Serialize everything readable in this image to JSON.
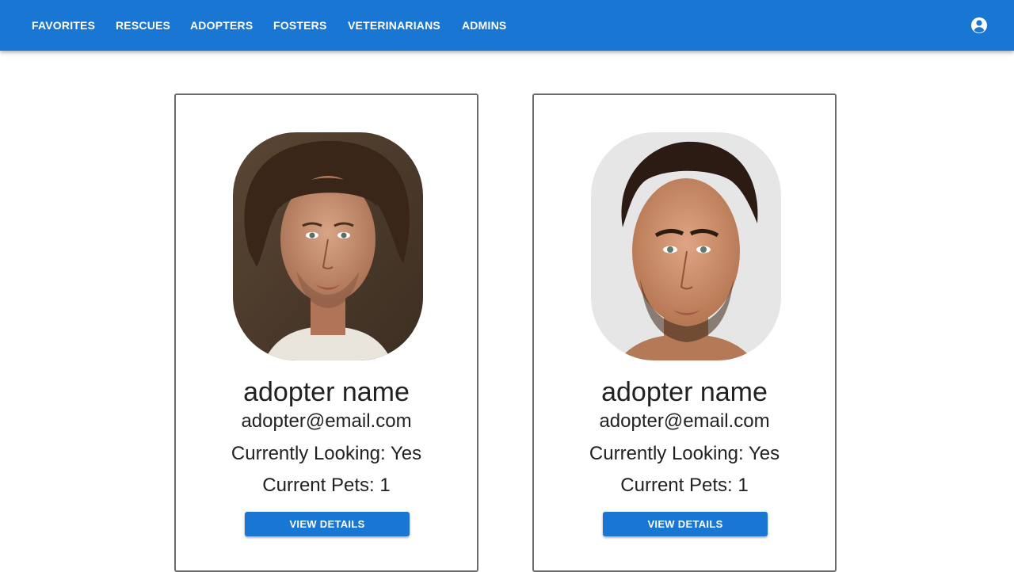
{
  "nav": {
    "items": [
      "FAVORITES",
      "RESCUES",
      "ADOPTERS",
      "FOSTERS",
      "VETERINARIANS",
      "ADMINS"
    ],
    "account_icon": "account-circle-icon"
  },
  "colors": {
    "primary": "#1976d2",
    "card_border": "#6b6b6b",
    "text": "#212121"
  },
  "cards": [
    {
      "name": "adopter name",
      "email": "adopter@email.com",
      "looking": "Currently Looking: Yes",
      "pets": "Current Pets: 1",
      "button": "VIEW DETAILS"
    },
    {
      "name": "adopter name",
      "email": "adopter@email.com",
      "looking": "Currently Looking: Yes",
      "pets": "Current Pets: 1",
      "button": "VIEW DETAILS"
    }
  ]
}
